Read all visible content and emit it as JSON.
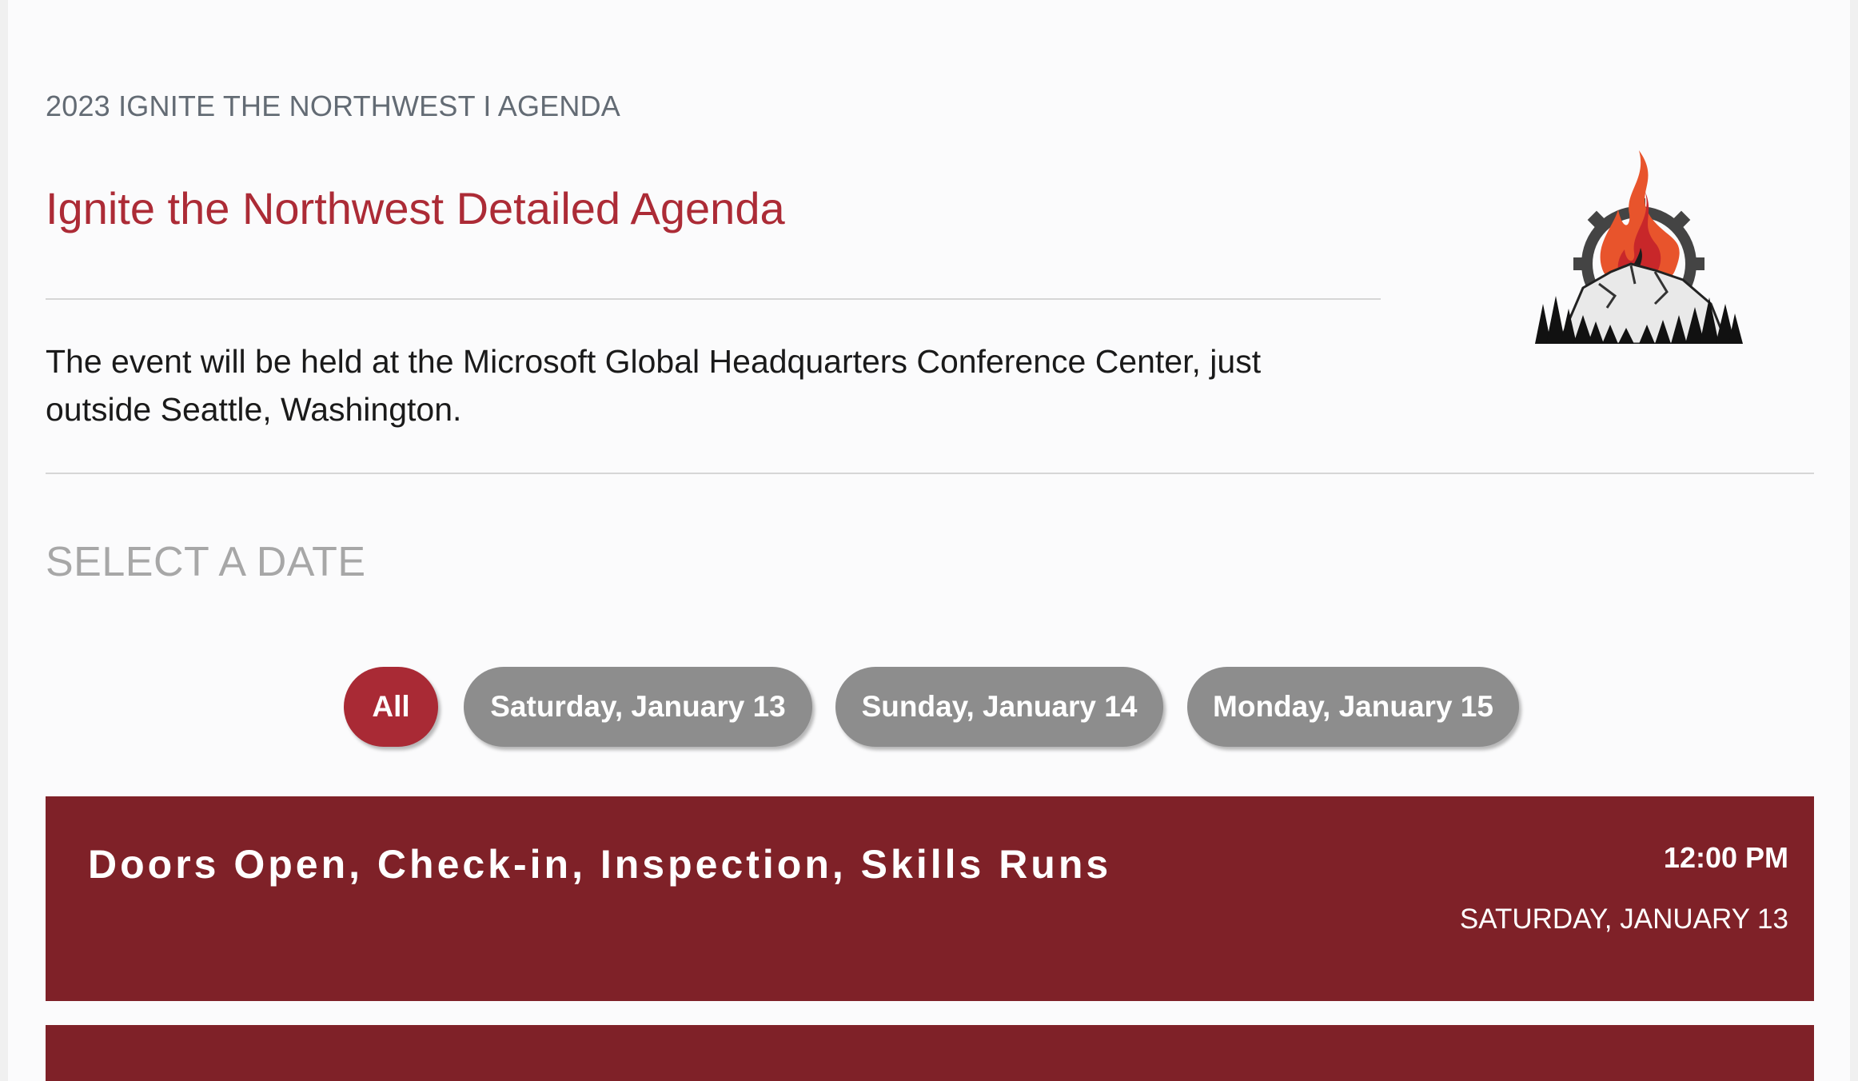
{
  "header": {
    "kicker": "2023 IGNITE THE NORTHWEST I AGENDA",
    "title": "Ignite the Northwest Detailed Agenda",
    "intro": "The event will be held at the Microsoft Global Headquarters Conference Center, just outside Seattle, Washington."
  },
  "logo": {
    "icon": "flame-gear-mountain-logo"
  },
  "date_filter": {
    "heading": "SELECT A DATE",
    "options": [
      {
        "label": "All",
        "selected": true
      },
      {
        "label": "Saturday, January 13",
        "selected": false
      },
      {
        "label": "Sunday, January 14",
        "selected": false
      },
      {
        "label": "Monday, January 15",
        "selected": false
      }
    ]
  },
  "events": [
    {
      "title": "Doors Open, Check-in, Inspection, Skills Runs",
      "time": "12:00 PM",
      "date": "SATURDAY, JANUARY 13"
    }
  ],
  "colors": {
    "accent": "#ac2b36",
    "event_bg": "#7f2128",
    "chip_inactive": "#8d8d8d",
    "chip_active": "#a92a35"
  }
}
